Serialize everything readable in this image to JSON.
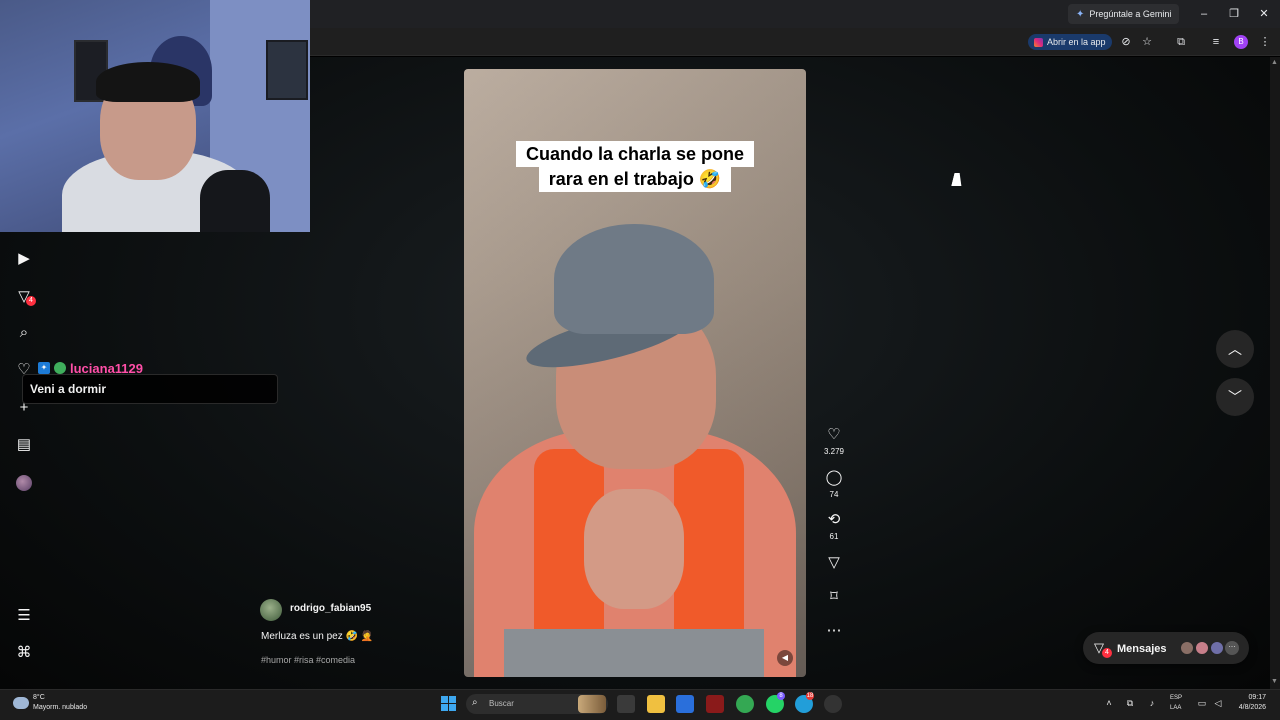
{
  "browser": {
    "gemini_label": "Pregúntale a Gemini",
    "open_app_label": "Abrir en la app",
    "profile_initial": "B"
  },
  "chat": {
    "username": "luciana1129",
    "message": "Veni a dormir"
  },
  "sidebar": {
    "notification_count": "4"
  },
  "post": {
    "username": "rodrigo_fabian95",
    "caption": "Merluza es un pez 🤣 🤦",
    "hashtags": "#humor #risa #comedia"
  },
  "video": {
    "overlay_line1": "Cuando la charla se pone",
    "overlay_line2": "rara en el trabajo 🤣"
  },
  "actions": {
    "likes": "3.279",
    "comments": "74",
    "reposts": "61"
  },
  "messages": {
    "label": "Mensajes",
    "badge": "4"
  },
  "taskbar": {
    "temperature": "8°C",
    "weather": "Mayorm. nublado",
    "search_placeholder": "Buscar",
    "lang_top": "ESP",
    "lang_bottom": "LAA",
    "time": "09:17",
    "date": "4/8/2026",
    "whatsapp_badge": "8",
    "discord_badge": "18"
  },
  "colors": {
    "accent_pink": "#ff4fa8",
    "notification_red": "#ff3040",
    "page_bg": "#0c0f10"
  }
}
